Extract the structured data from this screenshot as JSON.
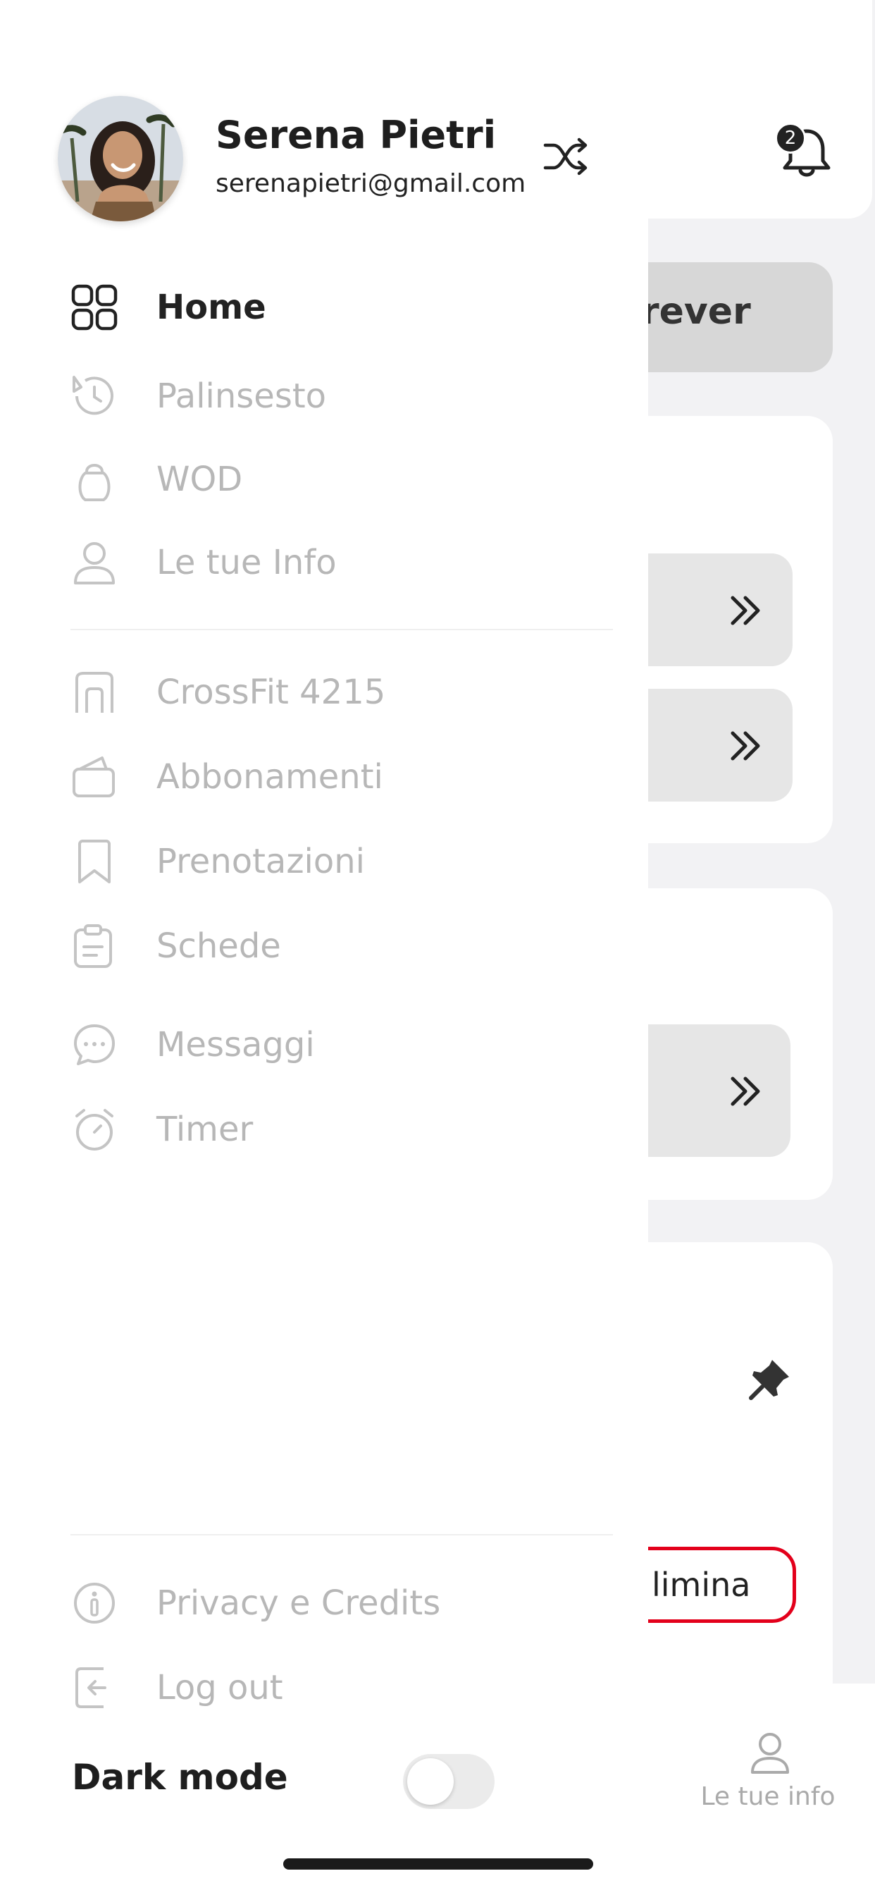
{
  "background": {
    "notification_count": "2",
    "pill_text": "rever",
    "delete_button_text": "limina",
    "bottom_tab_label": "Le tue info"
  },
  "user": {
    "name": "Serena Pietri",
    "email": "serenapietri@gmail.com"
  },
  "menu": {
    "primary": [
      {
        "label": "Home",
        "icon": "grid-icon",
        "active": true
      },
      {
        "label": "Palinsesto",
        "icon": "history-icon"
      },
      {
        "label": "WOD",
        "icon": "kettlebell-icon"
      },
      {
        "label": "Le tue Info",
        "icon": "user-icon"
      }
    ],
    "secondary": [
      {
        "label": "CrossFit 4215",
        "icon": "gym-icon"
      },
      {
        "label": "Abbonamenti",
        "icon": "wallet-icon"
      },
      {
        "label": "Prenotazioni",
        "icon": "bookmark-icon"
      },
      {
        "label": "Schede",
        "icon": "clipboard-icon"
      },
      {
        "label": "Messaggi",
        "icon": "chat-icon"
      },
      {
        "label": "Timer",
        "icon": "stopwatch-icon"
      }
    ],
    "footer": [
      {
        "label": "Privacy e Credits",
        "icon": "info-icon"
      },
      {
        "label": "Log out",
        "icon": "logout-icon"
      }
    ]
  },
  "settings": {
    "dark_mode_label": "Dark mode",
    "dark_mode_on": false
  },
  "colors": {
    "active_text": "#222222",
    "inactive_text": "#b7b7b7",
    "danger": "#e3001b"
  }
}
